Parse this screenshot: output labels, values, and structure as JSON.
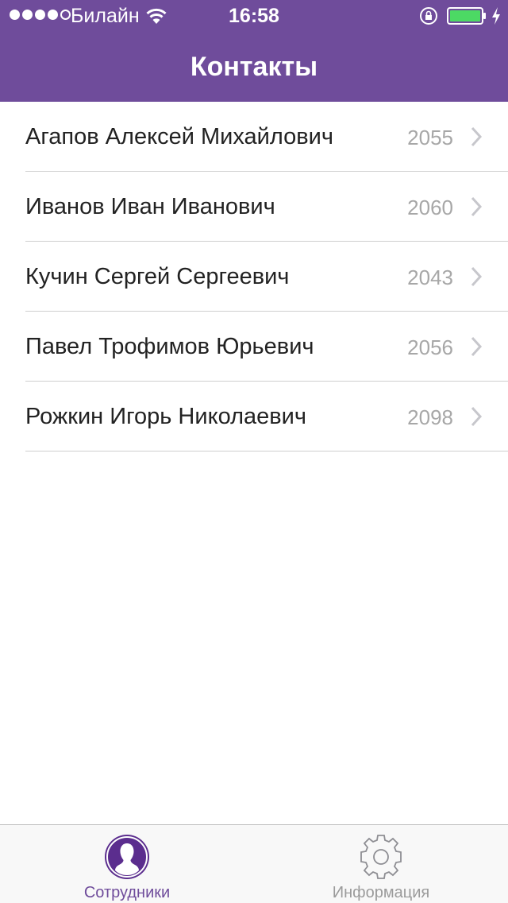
{
  "status_bar": {
    "carrier": "Билайн",
    "time": "16:58",
    "signal_strength": 4,
    "signal_max": 5,
    "battery_color": "#4cd964"
  },
  "nav": {
    "title": "Контакты",
    "color": "#6f4c9b"
  },
  "contacts": [
    {
      "name": "Агапов Алексей Михайлович",
      "ext": "2055"
    },
    {
      "name": "Иванов Иван Иванович",
      "ext": "2060"
    },
    {
      "name": "Кучин Сергей Сергеевич",
      "ext": "2043"
    },
    {
      "name": "Павел Трофимов Юрьевич",
      "ext": "2056"
    },
    {
      "name": "Рожкин Игорь Николаевич",
      "ext": "2098"
    }
  ],
  "tabbar": {
    "tabs": [
      {
        "label": "Сотрудники",
        "icon": "person-icon",
        "active": true
      },
      {
        "label": "Информация",
        "icon": "gear-icon",
        "active": false
      }
    ]
  }
}
